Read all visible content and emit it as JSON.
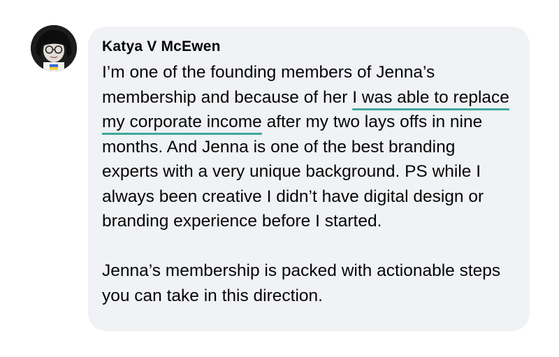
{
  "comment": {
    "author": "Katya V McEwen",
    "avatar_icon": "profile-photo-avatar",
    "paragraph1": {
      "before": "I’m one of the founding members of Jenna’s membership and because of her ",
      "highlight": "I was able to replace my corporate income",
      "after": " after my two lays offs in nine months. And Jenna is one of the best branding experts with a very unique background. PS while I always been creative I didn’t have digital design or branding experience before I started."
    },
    "paragraph2": "Jenna’s membership is packed with actionable steps you can take in this direction."
  },
  "colors": {
    "bubble_bg": "#f0f2f5",
    "text": "#050505",
    "underline": "#3fa89a"
  }
}
